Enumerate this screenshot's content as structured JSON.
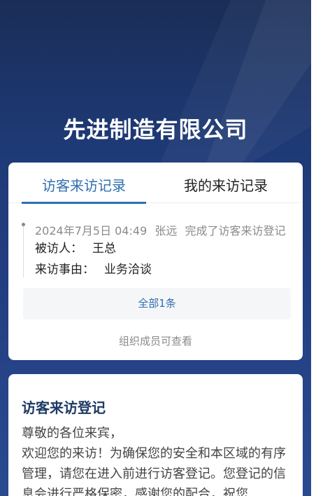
{
  "company": {
    "name": "先进制造有限公司"
  },
  "records_card": {
    "tabs": [
      {
        "label": "访客来访记录",
        "active": true
      },
      {
        "label": "我的来访记录",
        "active": false
      }
    ],
    "log": {
      "datetime": "2024年7月5日 04:49",
      "actor": "张远",
      "action": "完成了访客来访登记",
      "visitee_key": "被访人：",
      "visitee_value": "王总",
      "reason_key": "来访事由：",
      "reason_value": "业务洽谈"
    },
    "all_button_label": "全部1条",
    "org_note": "组织成员可查看"
  },
  "register_card": {
    "title": "访客来访登记",
    "lines": [
      "尊敬的各位来宾，",
      "欢迎您的来访！为确保您的安全和本区域的有序管理，请您在进入前进行访客登记。您登记的信息会进行严格保密，感谢您的配合，祝您"
    ]
  },
  "colors": {
    "accent": "#2f6fb0",
    "background_top": "#1a2d57",
    "background_bottom": "#2a4a90",
    "register_title": "#1d3a63"
  }
}
